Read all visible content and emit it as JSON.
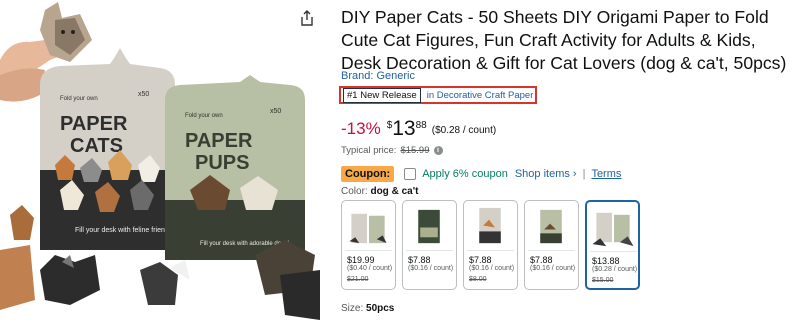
{
  "product": {
    "title": "DIY Paper Cats - 50 Sheets DIY Origami Paper to Fold Cute Cat Figures, Fun Craft Activity for Adults & Kids, Desk Decoration & Gift for Cat Lovers (dog & ca't, 50pcs)",
    "brand": "Brand: Generic",
    "badge": "#1 New Release",
    "badge_category": "in Decorative Craft Paper"
  },
  "image": {
    "box1": {
      "top": "Fold your own",
      "x50": "x50",
      "big1": "PAPER",
      "big2": "CATS",
      "footer": "Fill your desk with feline friends"
    },
    "box2": {
      "top": "Fold your own",
      "x50": "x50",
      "big1": "PAPER",
      "big2": "PUPS",
      "footer": "Fill your desk with adorable dogs!"
    }
  },
  "pricing": {
    "discount": "-13%",
    "currency": "$",
    "whole": "13",
    "fraction": "88",
    "per_unit": "($0.28 / count)",
    "typical_label": "Typical price:",
    "typical_price": "$15.99"
  },
  "coupon": {
    "label": "Coupon:",
    "text": "Apply 6% coupon",
    "shop": "Shop items ›",
    "separator": "|",
    "terms": "Terms"
  },
  "color": {
    "label": "Color:",
    "value": "dog & ca't"
  },
  "swatches": [
    {
      "price": "$19.99",
      "unit": "($0.40 / count)",
      "list": "$21.00"
    },
    {
      "price": "$7.88",
      "unit": "($0.16 / count)",
      "list": ""
    },
    {
      "price": "$7.88",
      "unit": "($0.16 / count)",
      "list": "$8.00"
    },
    {
      "price": "$7.88",
      "unit": "($0.16 / count)",
      "list": ""
    },
    {
      "price": "$13.88",
      "unit": "($0.28 / count)",
      "list": "$15.00"
    }
  ],
  "size": {
    "label": "Size:",
    "value": "50pcs"
  },
  "colors": {
    "accent_red": "#cc0c39",
    "link": "#2162a1",
    "coupon_bg": "#f7a847",
    "coupon_green": "#067d62"
  }
}
